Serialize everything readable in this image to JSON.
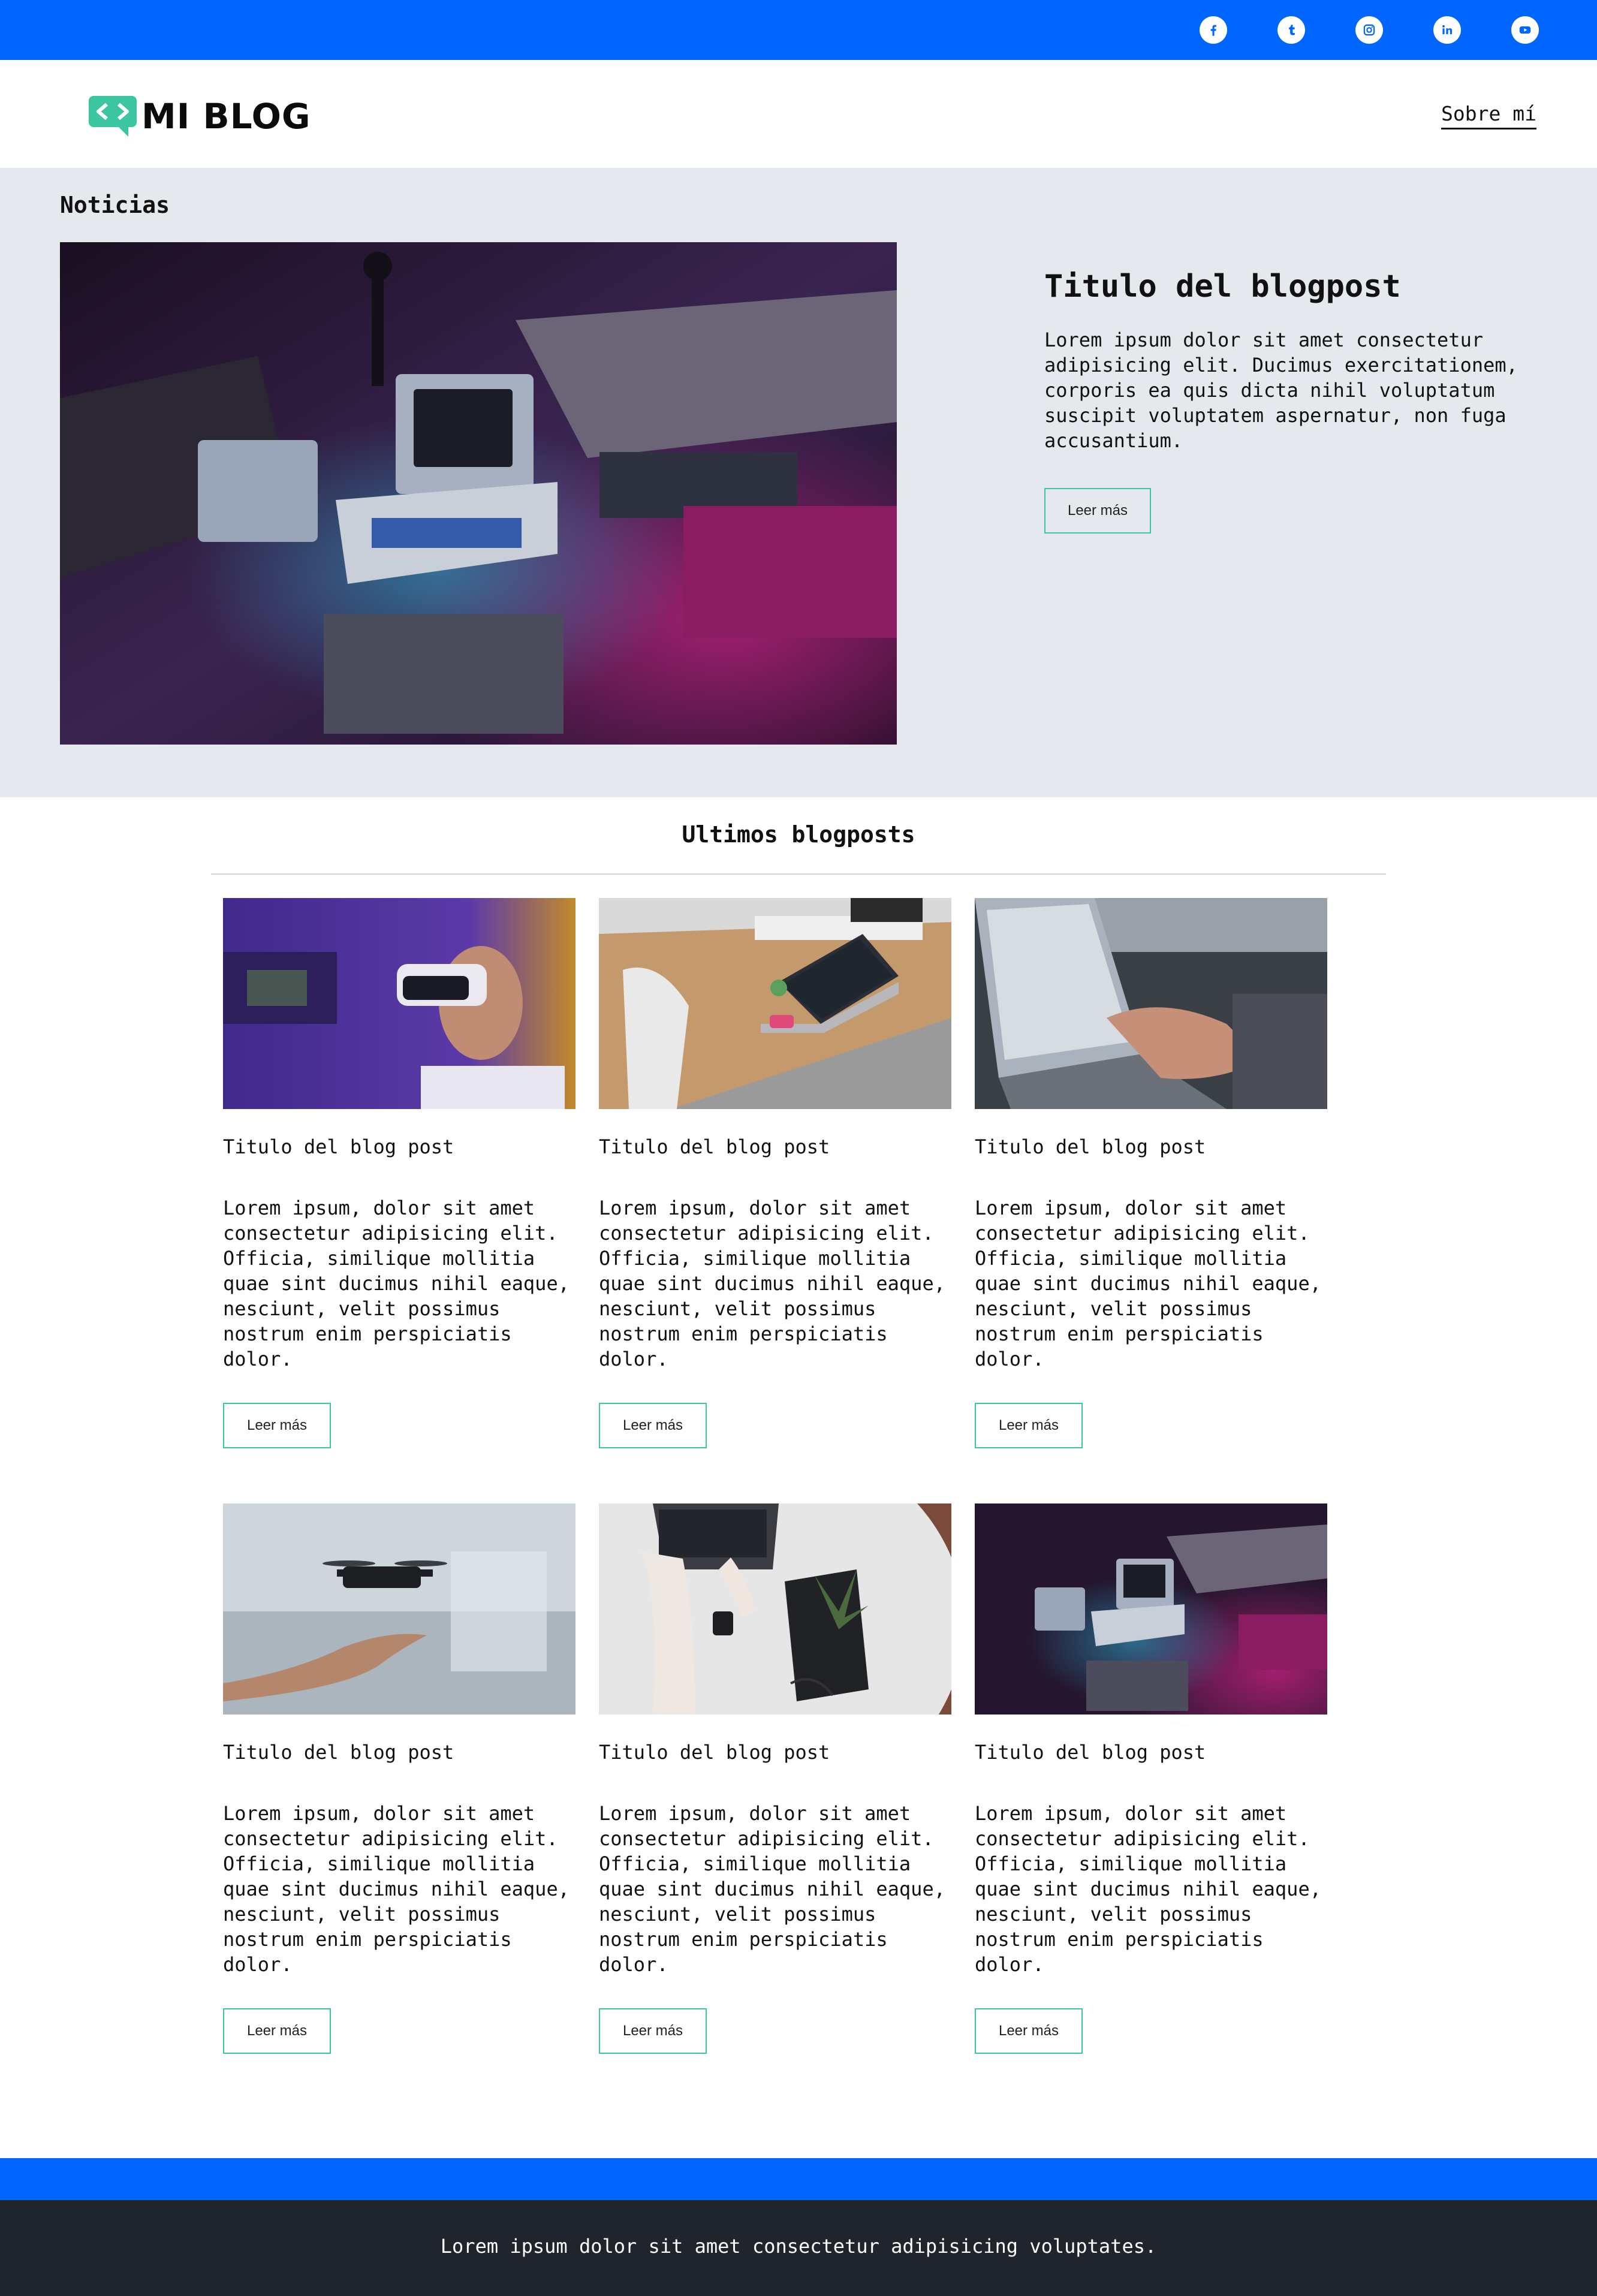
{
  "social": [
    {
      "name": "facebook-icon"
    },
    {
      "name": "tumblr-icon"
    },
    {
      "name": "instagram-icon"
    },
    {
      "name": "linkedin-icon"
    },
    {
      "name": "youtube-icon"
    }
  ],
  "header": {
    "logo_text": "MI BLOG",
    "nav_about": "Sobre mí"
  },
  "news": {
    "label": "Noticias",
    "title": "Titulo del blogpost",
    "text": "Lorem ipsum dolor sit amet consectetur adipisicing elit. Ducimus exercitationem, corporis ea quis dicta nihil voluptatum suscipit voluptatem aspernatur, non fuga accusantium.",
    "button": "Leer más",
    "image": "retro-computers-photo"
  },
  "latest": {
    "title": "Ultimos blogposts",
    "posts": [
      {
        "title": "Titulo del blog post",
        "text": "Lorem ipsum, dolor sit amet consectetur adipisicing elit. Officia, similique mollitia quae sint ducimus nihil eaque, nesciunt, velit possimus nostrum enim perspiciatis dolor.",
        "button": "Leer más",
        "image": "vr-headset-photo"
      },
      {
        "title": "Titulo del blog post",
        "text": "Lorem ipsum, dolor sit amet consectetur adipisicing elit. Officia, similique mollitia quae sint ducimus nihil eaque, nesciunt, velit possimus nostrum enim perspiciatis dolor.",
        "button": "Leer más",
        "image": "laptop-desk-photo"
      },
      {
        "title": "Titulo del blog post",
        "text": "Lorem ipsum, dolor sit amet consectetur adipisicing elit. Officia, similique mollitia quae sint ducimus nihil eaque, nesciunt, velit possimus nostrum enim perspiciatis dolor.",
        "button": "Leer más",
        "image": "typing-laptop-photo"
      },
      {
        "title": "Titulo del blog post",
        "text": "Lorem ipsum, dolor sit amet consectetur adipisicing elit. Officia, similique mollitia quae sint ducimus nihil eaque, nesciunt, velit possimus nostrum enim perspiciatis dolor.",
        "button": "Leer más",
        "image": "drone-hand-photo"
      },
      {
        "title": "Titulo del blog post",
        "text": "Lorem ipsum, dolor sit amet consectetur adipisicing elit. Officia, similique mollitia quae sint ducimus nihil eaque, nesciunt, velit possimus nostrum enim perspiciatis dolor.",
        "button": "Leer más",
        "image": "laptop-table-photo"
      },
      {
        "title": "Titulo del blog post",
        "text": "Lorem ipsum, dolor sit amet consectetur adipisicing elit. Officia, similique mollitia quae sint ducimus nihil eaque, nesciunt, velit possimus nostrum enim perspiciatis dolor.",
        "button": "Leer más",
        "image": "retro-computers-photo"
      }
    ]
  },
  "footer": {
    "text": "Lorem ipsum dolor sit amet consectetur adipisicing voluptates."
  },
  "colors": {
    "topbar": "#0066ff",
    "accent_green": "#3cc69f",
    "hero_bg": "#e5e8ec",
    "footer_bg": "#20242c"
  }
}
